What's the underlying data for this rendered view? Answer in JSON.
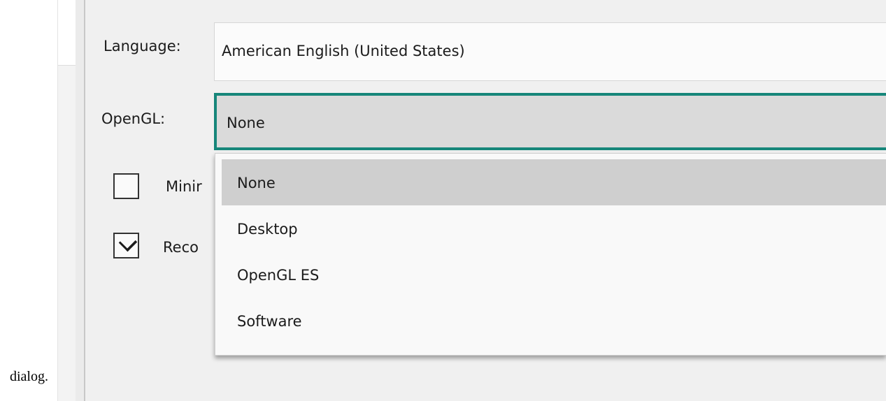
{
  "caption": "dialog.",
  "language": {
    "label": "Language:",
    "value": "American English (United States)"
  },
  "opengl": {
    "label": "OpenGL:",
    "value": "None",
    "options": [
      "None",
      "Desktop",
      "OpenGL ES",
      "Software"
    ],
    "selected_index": 0
  },
  "checkboxes": [
    {
      "label_visible": "Minir",
      "checked": false
    },
    {
      "label_visible": "Reco",
      "checked": true
    }
  ],
  "colors": {
    "focus_border": "#16867a",
    "selected_item": "#cfcfcf",
    "panel_bg": "#f0f0f0"
  }
}
